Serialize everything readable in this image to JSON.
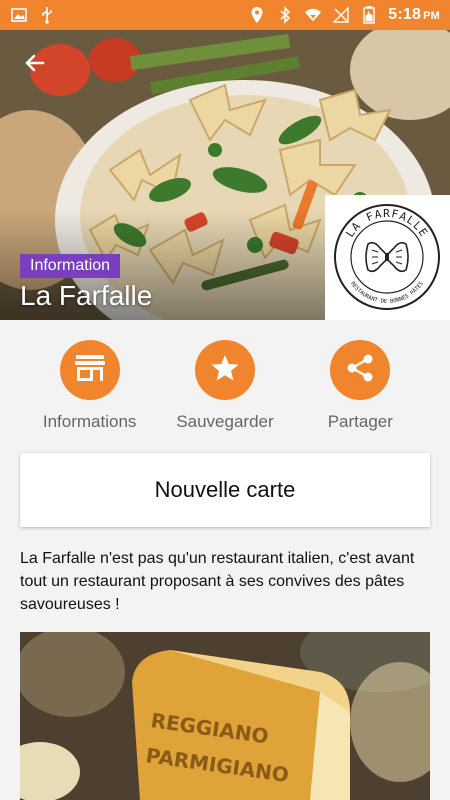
{
  "status_bar": {
    "time": "5:18",
    "ampm": "PM",
    "left_icons": [
      "image-icon",
      "usb-icon"
    ],
    "right_icons": [
      "location-icon",
      "bluetooth-icon",
      "wifi-icon",
      "signal-icon",
      "battery-icon"
    ]
  },
  "hero": {
    "badge": "Information",
    "title": "La Farfalle",
    "logo_text_top": "LA FARFALLE",
    "logo_text_bottom": "RESTAURANT DE BONNES PÂTES"
  },
  "actions": [
    {
      "label": "Informations",
      "icon": "store-icon"
    },
    {
      "label": "Sauvegarder",
      "icon": "star-icon"
    },
    {
      "label": "Partager",
      "icon": "share-icon"
    }
  ],
  "card_button": {
    "label": "Nouvelle carte"
  },
  "description": "La Farfalle n'est pas qu'un restaurant italien, c'est avant tout un restaurant proposant à ses convives des pâtes savoureuses !",
  "bottom_image": {
    "text_1": "REGGIANO",
    "text_2": "PARMIGIANO"
  },
  "colors": {
    "accent": "#f0852d",
    "badge": "#7a3fbf"
  }
}
